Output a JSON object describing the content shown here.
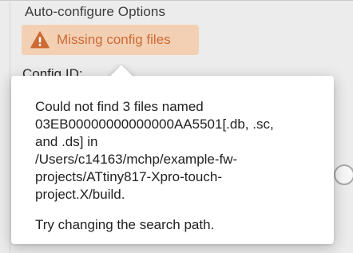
{
  "section": {
    "title": "Auto-configure Options"
  },
  "warning": {
    "label": "Missing config files",
    "icon": "warning-triangle-icon",
    "icon_color": "#cc6a33",
    "badge_color": "#f3d0b4"
  },
  "config": {
    "id_label": "Config ID:"
  },
  "popover": {
    "message_lines": [
      "Could not find 3 files named",
      "03EB00000000000000AA5501[.db, .sc,",
      "and .ds] in",
      "/Users/c14163/mchp/example-fw-",
      "projects/ATtiny817-Xpro-touch-",
      "project.X/build."
    ],
    "hint": "Try changing the search path."
  }
}
